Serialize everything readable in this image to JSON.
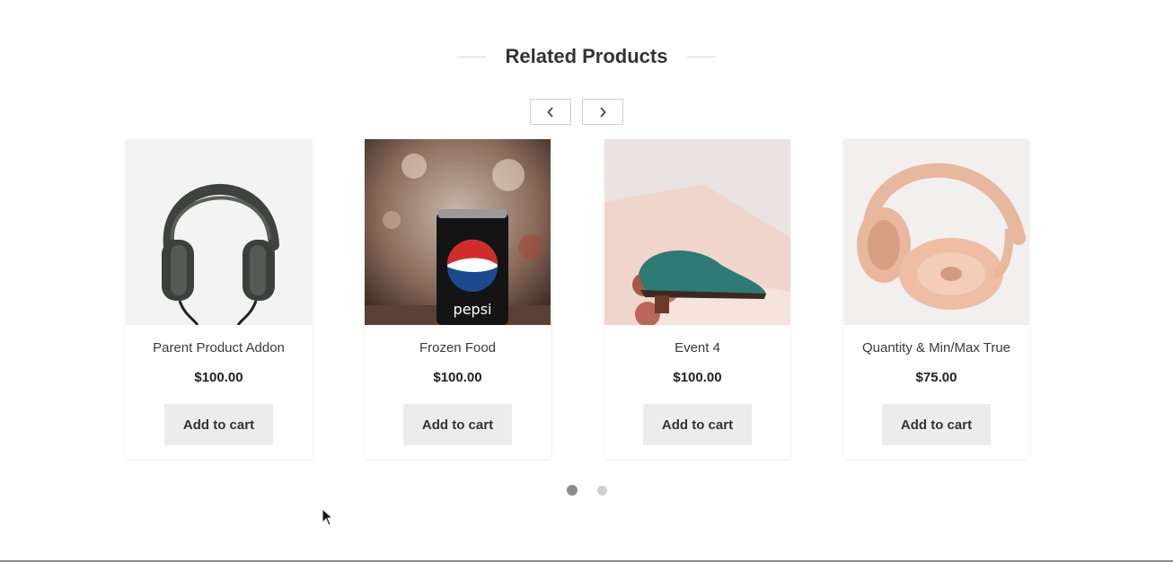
{
  "section": {
    "title": "Related Products"
  },
  "carousel": {
    "prev_icon": "chevron-left-icon",
    "next_icon": "chevron-right-icon",
    "active_page": 1,
    "page_count": 2
  },
  "products": [
    {
      "name": "Parent Product Addon",
      "price": "$100.00",
      "button": "Add to cart",
      "image": "over-ear-headphones-dark"
    },
    {
      "name": "Frozen Food",
      "price": "$100.00",
      "button": "Add to cart",
      "image": "pepsi-can"
    },
    {
      "name": "Event 4",
      "price": "$100.00",
      "button": "Add to cart",
      "image": "teal-shoe"
    },
    {
      "name": "Quantity & Min/Max True",
      "price": "$75.00",
      "button": "Add to cart",
      "image": "rose-gold-headphones"
    }
  ],
  "colors": {
    "button_bg": "#ececec",
    "dot_active": "#8b8b8b",
    "dot_inactive": "#cfcfcf"
  }
}
